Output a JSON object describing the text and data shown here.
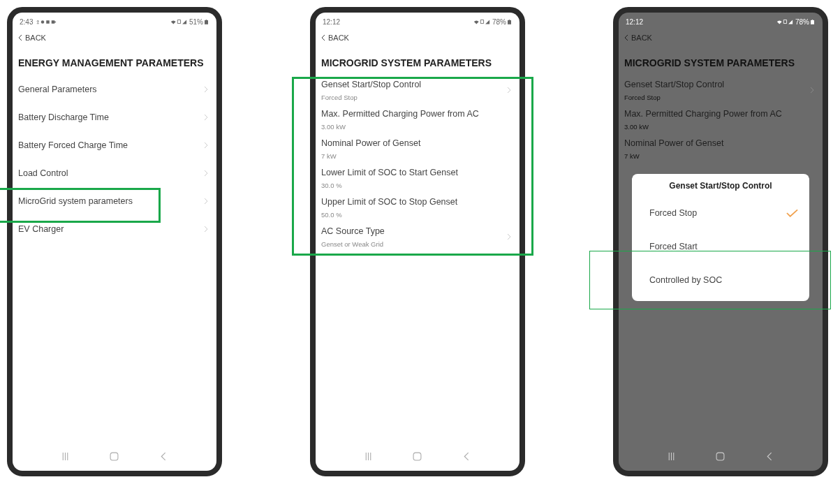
{
  "phones": [
    {
      "status": {
        "time": "2:43",
        "battery": "51%",
        "notifications": true
      },
      "back": "BACK",
      "title": "ENERGY MANAGEMENT PARAMETERS",
      "dimmed": false,
      "items": [
        {
          "label": "General Parameters",
          "chevron": true
        },
        {
          "label": "Battery Discharge Time",
          "chevron": true
        },
        {
          "label": "Battery Forced Charge Time",
          "chevron": true
        },
        {
          "label": "Load Control",
          "chevron": true
        },
        {
          "label": "MicroGrid system parameters",
          "chevron": true,
          "highlighted": true
        },
        {
          "label": "EV Charger",
          "chevron": true
        }
      ]
    },
    {
      "status": {
        "time": "12:12",
        "battery": "78%"
      },
      "back": "BACK",
      "title": "MICROGRID SYSTEM PARAMETERS",
      "dimmed": false,
      "list_highlighted": true,
      "items": [
        {
          "label": "Genset Start/Stop Control",
          "value": "Forced Stop",
          "chevron": true
        },
        {
          "label": "Max. Permitted Charging Power from AC",
          "value": "3.00 kW",
          "chevron": false
        },
        {
          "label": "Nominal Power of Genset",
          "value": "7 kW",
          "chevron": false
        },
        {
          "label": "Lower Limit of SOC to Start Genset",
          "value": "30.0 %",
          "chevron": false
        },
        {
          "label": "Upper Limit of SOC to Stop Genset",
          "value": "50.0 %",
          "chevron": false
        },
        {
          "label": "AC Source Type",
          "value": "Genset or Weak Grid",
          "chevron": true
        }
      ]
    },
    {
      "status": {
        "time": "12:12",
        "battery": "78%"
      },
      "back": "BACK",
      "title": "MICROGRID SYSTEM PARAMETERS",
      "dimmed": true,
      "items": [
        {
          "label": "Genset Start/Stop Control",
          "value": "Forced Stop",
          "chevron": true
        },
        {
          "label": "Max. Permitted Charging Power from AC",
          "value": "3.00 kW",
          "chevron": false
        },
        {
          "label": "Nominal Power of Genset",
          "value": "7 kW",
          "chevron": false
        }
      ],
      "dialog": {
        "title": "Genset Start/Stop Control",
        "options": [
          {
            "label": "Forced Stop",
            "selected": true
          },
          {
            "label": "Forced Start",
            "selected": false
          },
          {
            "label": "Controlled by SOC",
            "selected": false,
            "highlighted": true
          }
        ]
      }
    }
  ]
}
